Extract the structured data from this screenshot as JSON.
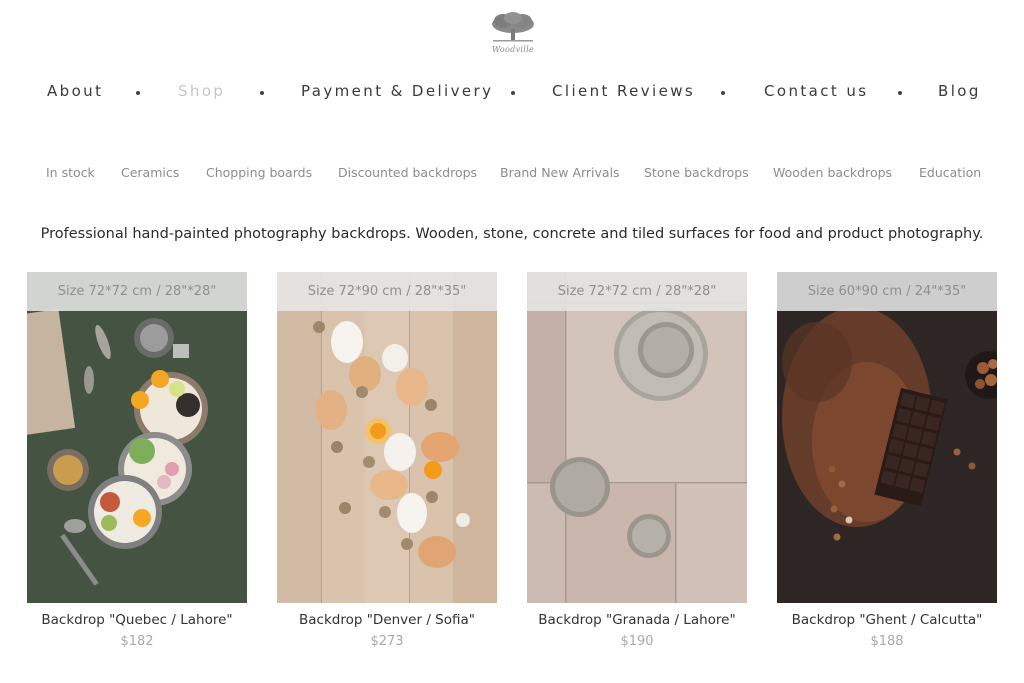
{
  "brand": {
    "logo_text": "Woodville",
    "logo_icon": "tree-icon"
  },
  "main_nav": [
    {
      "label": "About",
      "active": false
    },
    {
      "label": "Shop",
      "active": true
    },
    {
      "label": "Payment & Delivery",
      "active": false
    },
    {
      "label": "Client Reviews",
      "active": false
    },
    {
      "label": "Contact us",
      "active": false
    },
    {
      "label": "Blog",
      "active": false
    }
  ],
  "sub_nav": [
    "In stock",
    "Ceramics",
    "Chopping boards",
    "Discounted backdrops",
    "Brand New Arrivals",
    "Stone backdrops",
    "Wooden backdrops",
    "Education"
  ],
  "tagline": "Professional hand-painted photography backdrops. Wooden, stone, concrete and tiled surfaces for food and product photography.",
  "products": [
    {
      "size": "Size 72*72 cm / 28\"*28\"",
      "name": "Backdrop \"Quebec / Lahore\"",
      "price": "$182",
      "surface": "dark green plaster"
    },
    {
      "size": "Size 72*90 cm / 28\"*35\"",
      "name": "Backdrop \"Denver / Sofia\"",
      "price": "$273",
      "surface": "light wooden planks"
    },
    {
      "size": "Size 72*72 cm / 28\"*28\"",
      "name": "Backdrop \"Granada / Lahore\"",
      "price": "$190",
      "surface": "pink-grey stone tiles"
    },
    {
      "size": "Size 60*90 cm / 24\"*35\"",
      "name": "Backdrop \"Ghent / Calcutta\"",
      "price": "$188",
      "surface": "dark textured concrete"
    }
  ],
  "colors": {
    "nav_text": "#3a3a3a",
    "nav_active": "#c6c6c6",
    "subnav_text": "#8c8c8c",
    "price_text": "#a9a9a9"
  }
}
